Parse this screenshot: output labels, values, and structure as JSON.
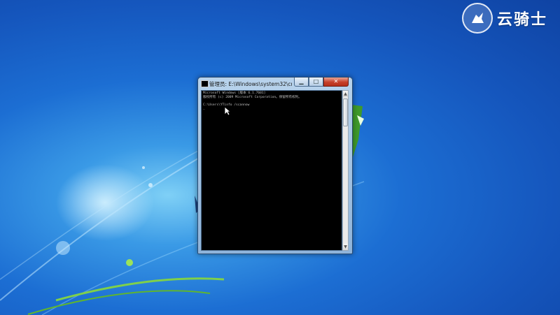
{
  "watermark": {
    "text": "云骑士"
  },
  "window": {
    "title": "管理员: E:\\Windows\\system32\\cmd.exe",
    "controls": {
      "minimize": "▁",
      "maximize": "□",
      "close": "✕"
    }
  },
  "console": {
    "lines": [
      "Microsoft Windows [版本 6.1.7601]",
      "版权所有 (c) 2009 Microsoft Corporation。保留所有权利。",
      "",
      "C:\\Users\\YTinfo /scannow",
      "_"
    ]
  },
  "colors": {
    "desktop_blue": "#1c6ed3",
    "console_bg": "#000000",
    "console_text": "#c0c0c0",
    "close_red": "#c6402a"
  },
  "icons": [
    "cmd-app-icon",
    "knight-logo-icon",
    "mouse-pointer-icon"
  ]
}
